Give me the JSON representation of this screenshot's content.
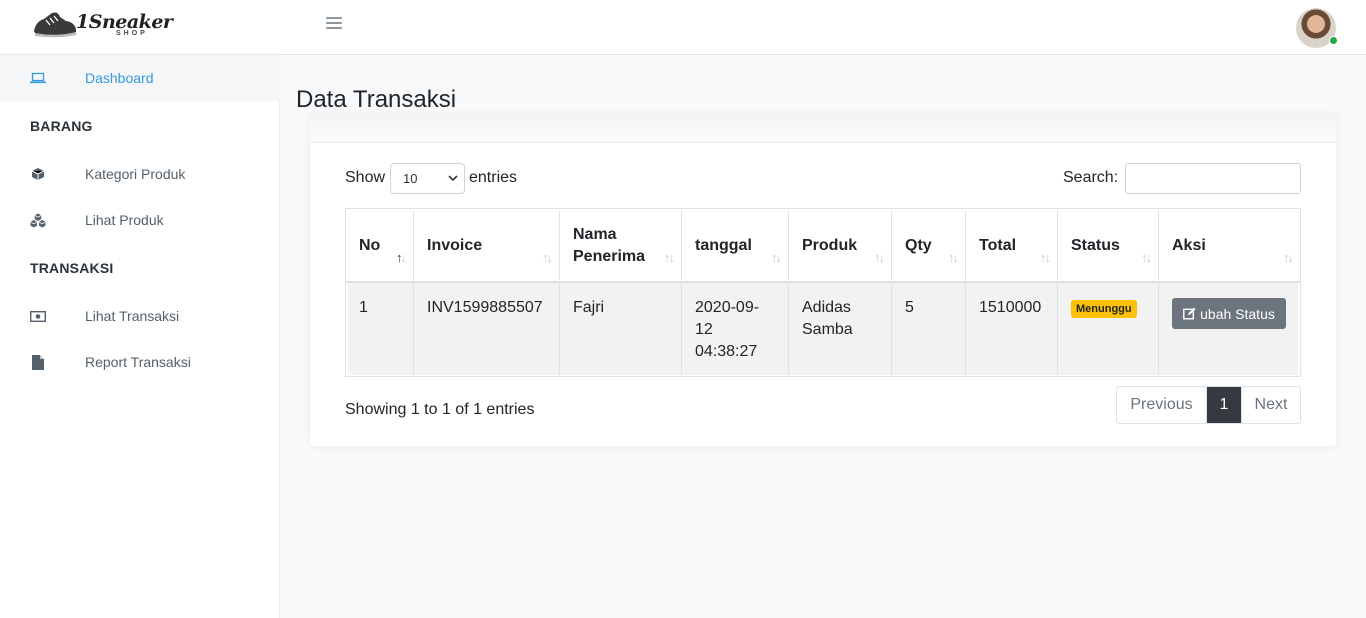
{
  "brand": {
    "logo_text": "1Sneaker",
    "logo_sub": "SHOP"
  },
  "navbar": {
    "menu_icon": "hamburger-icon",
    "avatar_status_color": "#28a745"
  },
  "sidebar": {
    "items": [
      {
        "label": "Dashboard",
        "icon": "laptop-icon",
        "active": true
      },
      {
        "heading": "BARANG"
      },
      {
        "label": "Kategori Produk",
        "icon": "cube-icon"
      },
      {
        "label": "Lihat Produk",
        "icon": "cubes-icon"
      },
      {
        "heading": "TRANSAKSI"
      },
      {
        "label": "Lihat Transaksi",
        "icon": "money-icon"
      },
      {
        "label": "Report Transaksi",
        "icon": "file-icon"
      }
    ]
  },
  "page": {
    "title": "Data Transaksi"
  },
  "table_controls": {
    "show_label": "Show",
    "entries_value": "10",
    "entries_label": "entries",
    "search_label": "Search:",
    "search_value": ""
  },
  "table": {
    "columns": [
      "No",
      "Invoice",
      "Nama Penerima",
      "tanggal",
      "Produk",
      "Qty",
      "Total",
      "Status",
      "Aksi"
    ],
    "rows": [
      {
        "no": "1",
        "invoice": "INV1599885507",
        "penerima": "Fajri",
        "tanggal": "2020-09-12 04:38:27",
        "produk": "Adidas Samba",
        "qty": "5",
        "total": "1510000",
        "status": "Menunggu",
        "aksi": "ubah Status"
      }
    ]
  },
  "footer": {
    "info": "Showing 1 to 1 of 1 entries",
    "prev": "Previous",
    "page": "1",
    "next": "Next"
  },
  "colors": {
    "accent": "#3498db",
    "status_badge": "#ffc107",
    "action_button": "#6c757d",
    "active_page": "#343a40"
  }
}
